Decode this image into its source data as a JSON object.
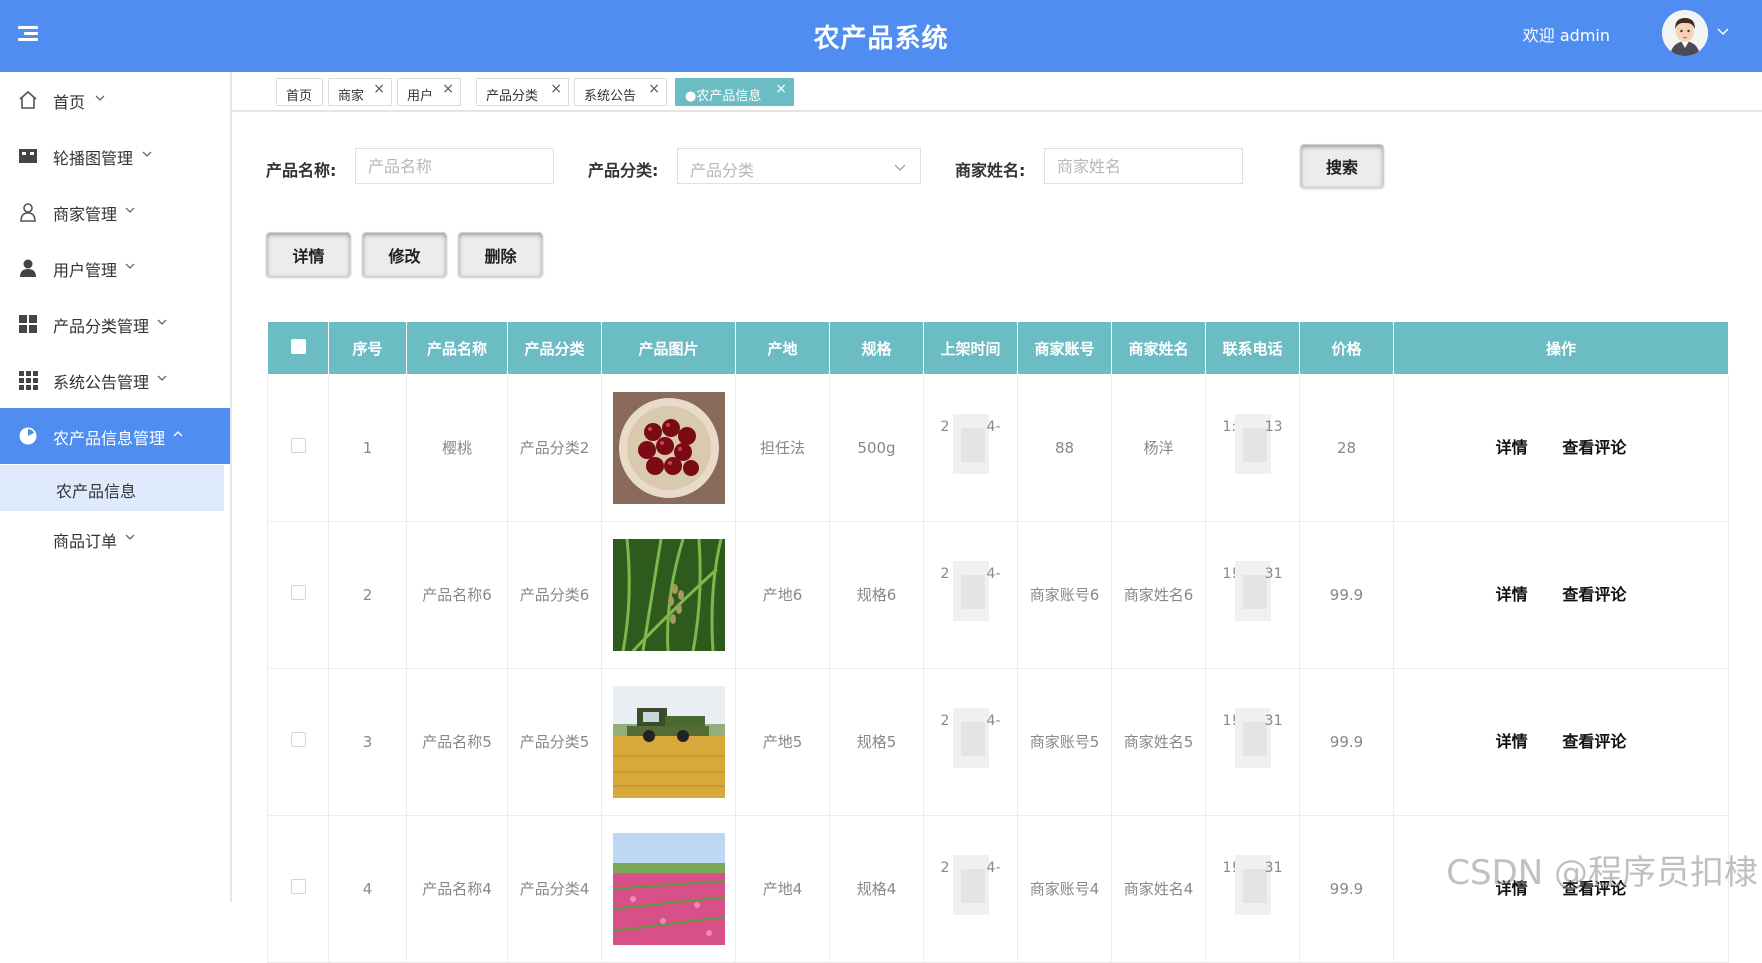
{
  "header": {
    "title": "农产品系统",
    "welcome": "欢迎 admin",
    "bg_color": "#4f8ef0"
  },
  "sidebar": {
    "items": [
      {
        "label": "首页",
        "icon": "home-icon"
      },
      {
        "label": "轮播图管理",
        "icon": "carousel-icon"
      },
      {
        "label": "商家管理",
        "icon": "merchant-icon"
      },
      {
        "label": "用户管理",
        "icon": "user-icon"
      },
      {
        "label": "产品分类管理",
        "icon": "category-grid-icon"
      },
      {
        "label": "系统公告管理",
        "icon": "apps-grid-icon"
      },
      {
        "label": "农产品信息管理",
        "icon": "pie-chart-icon",
        "active": true
      },
      {
        "label": "商品订单",
        "icon": ""
      }
    ],
    "sub_item": "农产品信息"
  },
  "tabs": [
    {
      "label": "首页",
      "closable": false
    },
    {
      "label": "商家",
      "closable": true
    },
    {
      "label": "用户",
      "closable": true
    },
    {
      "label": "产品分类",
      "closable": true
    },
    {
      "label": "系统公告",
      "closable": true
    },
    {
      "label": "●农产品信息",
      "closable": true,
      "active": true
    }
  ],
  "filters": {
    "name_label": "产品名称:",
    "name_placeholder": "产品名称",
    "category_label": "产品分类:",
    "category_placeholder": "产品分类",
    "merchant_label": "商家姓名:",
    "merchant_placeholder": "商家姓名",
    "search_button": "搜索"
  },
  "actions": {
    "detail": "详情",
    "edit": "修改",
    "delete": "删除"
  },
  "table": {
    "columns": [
      "序号",
      "产品名称",
      "产品分类",
      "产品图片",
      "产地",
      "规格",
      "上架时间",
      "商家账号",
      "商家姓名",
      "联系电话",
      "价格",
      "操作"
    ],
    "row_actions": {
      "detail": "详情",
      "comments": "查看评论"
    },
    "rows": [
      {
        "index": "1",
        "name": "樱桃",
        "category": "产品分类2",
        "image": "cherries",
        "origin": "担任法",
        "spec": "500g",
        "time_a": "2",
        "time_b": "4-",
        "account": "88",
        "merchant": "杨洋",
        "phone_a": "1:",
        "phone_b": "13",
        "price": "28"
      },
      {
        "index": "2",
        "name": "产品名称6",
        "category": "产品分类6",
        "image": "rice-plants",
        "origin": "产地6",
        "spec": "规格6",
        "time_a": "2",
        "time_b": "4-",
        "account": "商家账号6",
        "merchant": "商家姓名6",
        "phone_a": "1!",
        "phone_b": "31",
        "price": "99.9"
      },
      {
        "index": "3",
        "name": "产品名称5",
        "category": "产品分类5",
        "image": "harvester-field",
        "origin": "产地5",
        "spec": "规格5",
        "time_a": "2",
        "time_b": "4-",
        "account": "商家账号5",
        "merchant": "商家姓名5",
        "phone_a": "1!",
        "phone_b": "31",
        "price": "99.9"
      },
      {
        "index": "4",
        "name": "产品名称4",
        "category": "产品分类4",
        "image": "flower-field",
        "origin": "产地4",
        "spec": "规格4",
        "time_a": "2",
        "time_b": "4-",
        "account": "商家账号4",
        "merchant": "商家姓名4",
        "phone_a": "1!",
        "phone_b": "31",
        "price": "99.9"
      }
    ]
  },
  "watermark": "CSDN @程序员扣棣",
  "colors": {
    "accent": "#4f8ef0",
    "table_header": "#6cbcc4",
    "active_sub": "#dfeafc"
  }
}
